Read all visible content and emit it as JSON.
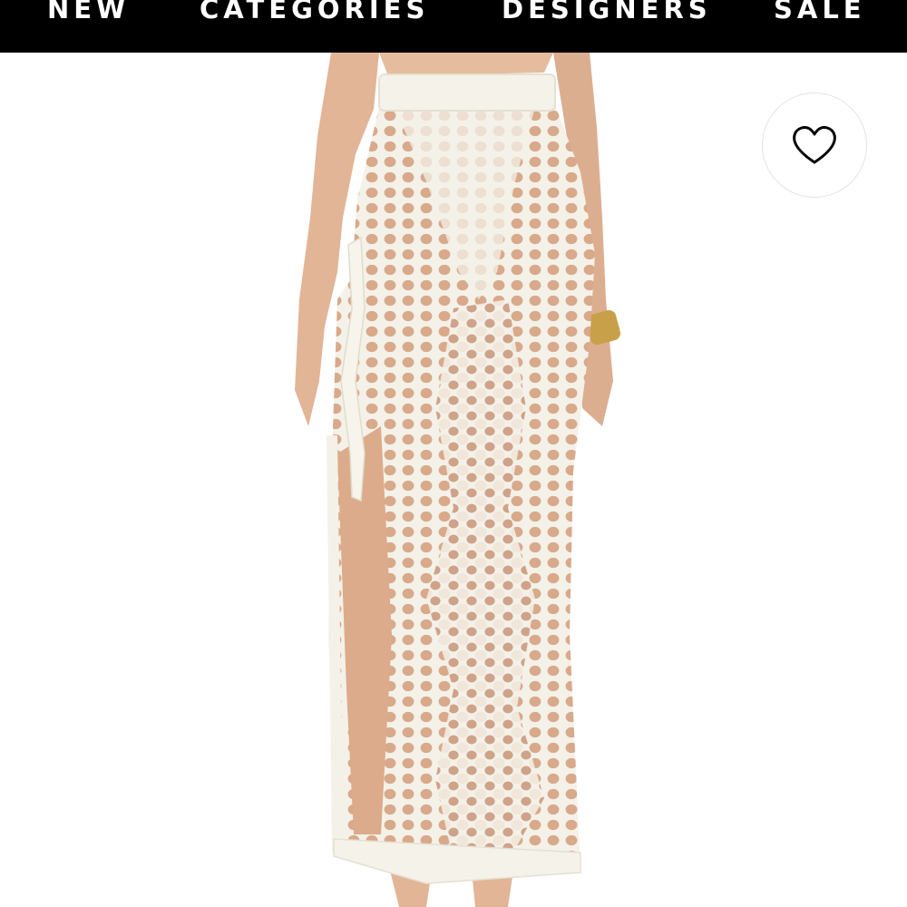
{
  "nav": {
    "items": [
      {
        "label": "NEW"
      },
      {
        "label": "CATEGORIES"
      },
      {
        "label": "DESIGNERS"
      },
      {
        "label": "SALE"
      }
    ],
    "background": "#000000",
    "text_color": "#ffffff"
  },
  "product": {
    "image": "crochet-maxi-skirt-back-view",
    "garment_color": "#f4f1e8"
  },
  "wishlist": {
    "icon": "heart-outline-icon"
  }
}
